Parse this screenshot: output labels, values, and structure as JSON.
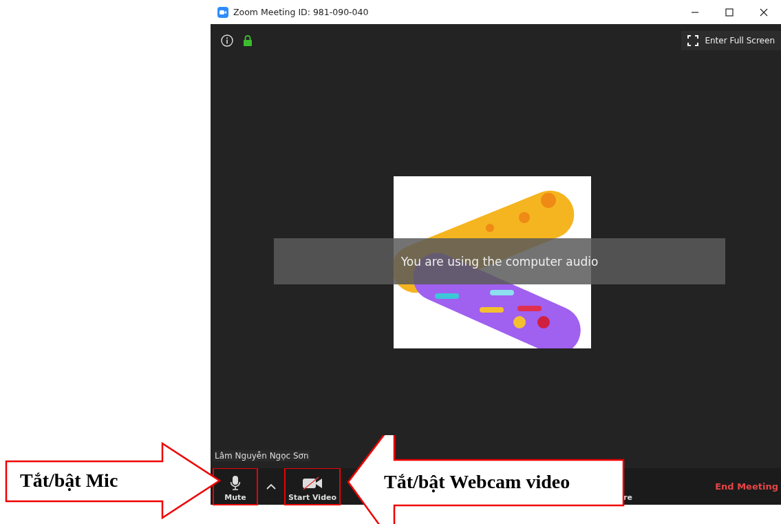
{
  "window": {
    "title": "Zoom Meeting ID: 981-090-040"
  },
  "top_bar": {
    "fullscreen_button": "Enter Full Screen"
  },
  "notice": "You are using the computer audio",
  "participant_name": "Lâm Nguyễn Ngọc Sơn",
  "toolbar": {
    "buttons": [
      {
        "label": "Mute",
        "kind": "mic"
      },
      {
        "label": "Start Video",
        "kind": "video"
      },
      {
        "label": "re",
        "kind": "share"
      }
    ],
    "end_button": "End Meeting"
  },
  "callouts": [
    {
      "text": "Tắt/bật Mic",
      "kind": "right-arrow"
    },
    {
      "text": "Tắt/bật Webcam video",
      "kind": "left-arrow"
    }
  ]
}
